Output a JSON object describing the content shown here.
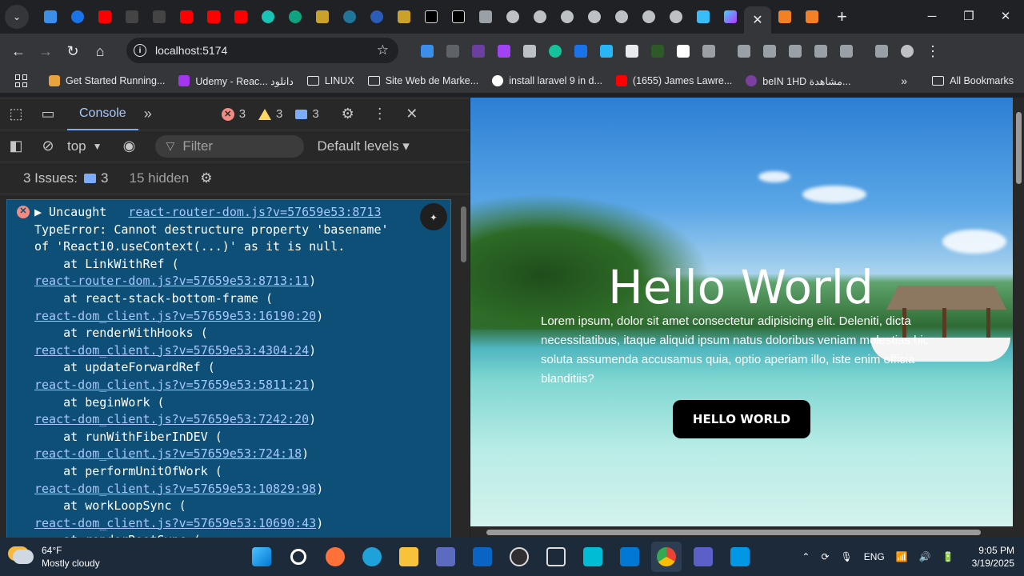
{
  "browser": {
    "url": "localhost:5174",
    "bookmarks": [
      {
        "label": "Get Started Running...",
        "color": "#e8a33d"
      },
      {
        "label": "Udemy - Reac... دانلود",
        "color": "#a435f0"
      },
      {
        "label": "LINUX",
        "folder": true
      },
      {
        "label": "Site Web de Marke...",
        "folder": true
      },
      {
        "label": "install laravel 9 in d...",
        "color": "#ffffff"
      },
      {
        "label": "(1655) James Lawre...",
        "color": "#ff0000"
      },
      {
        "label": "beIN 1HD مشاهدة...",
        "color": "#7b3fa0"
      }
    ],
    "all_bookmarks": "All Bookmarks",
    "more": "»",
    "new_tab": "+",
    "tab_close": "✕",
    "window_min": "─",
    "window_max": "❐",
    "window_close": "✕",
    "menu": "⌄",
    "back": "←",
    "forward": "→",
    "reload": "↻",
    "home": "⌂",
    "bookmark_star": "☆",
    "info": "i"
  },
  "devtools": {
    "console_tab": "Console",
    "more_tabs": "»",
    "errors": "3",
    "warnings": "3",
    "messages": "3",
    "context": "top",
    "filter_placeholder": "Filter",
    "levels": "Default levels ▾",
    "issues_label": "3 Issues:",
    "issues_count": "3",
    "hidden": "15 hidden",
    "error_lines": [
      {
        "text": "▶ Uncaught   ",
        "link": "react-router-dom.js?v=57659e53:8713"
      },
      {
        "text": "TypeError: Cannot destructure property 'basename'"
      },
      {
        "text": "of 'React10.useContext(...)' as it is null."
      },
      {
        "text": "    at LinkWithRef ("
      },
      {
        "link": "react-router-dom.js?v=57659e53:8713:11",
        "after": ")"
      },
      {
        "text": "    at react-stack-bottom-frame ("
      },
      {
        "link": "react-dom_client.js?v=57659e53:16190:20",
        "after": ")"
      },
      {
        "text": "    at renderWithHooks ("
      },
      {
        "link": "react-dom_client.js?v=57659e53:4304:24",
        "after": ")"
      },
      {
        "text": "    at updateForwardRef ("
      },
      {
        "link": "react-dom_client.js?v=57659e53:5811:21",
        "after": ")"
      },
      {
        "text": "    at beginWork ("
      },
      {
        "link": "react-dom_client.js?v=57659e53:7242:20",
        "after": ")"
      },
      {
        "text": "    at runWithFiberInDEV ("
      },
      {
        "link": "react-dom_client.js?v=57659e53:724:18",
        "after": ")"
      },
      {
        "text": "    at performUnitOfWork ("
      },
      {
        "link": "react-dom_client.js?v=57659e53:10829:98",
        "after": ")"
      },
      {
        "text": "    at workLoopSync ("
      },
      {
        "link": "react-dom_client.js?v=57659e53:10690:43",
        "after": ")"
      },
      {
        "text": "    at renderRootSync ("
      }
    ]
  },
  "page": {
    "title": "Hello World",
    "text": "Lorem ipsum, dolor sit amet consectetur adipisicing elit. Deleniti, dicta necessitatibus, itaque aliquid ipsum natus doloribus veniam molestias hic soluta assumenda accusamus quia, optio aperiam illo, iste enim officia blanditiis?",
    "button": "HELLO WORLD"
  },
  "taskbar": {
    "temperature": "64°F",
    "weather": "Mostly cloudy",
    "lang": "ENG",
    "time": "9:05 PM",
    "date": "3/19/2025",
    "tray_chevron": "⌃"
  },
  "colors": {
    "accent": "#a8c7fa",
    "error": "#f28b82",
    "warning": "#fdd663"
  }
}
